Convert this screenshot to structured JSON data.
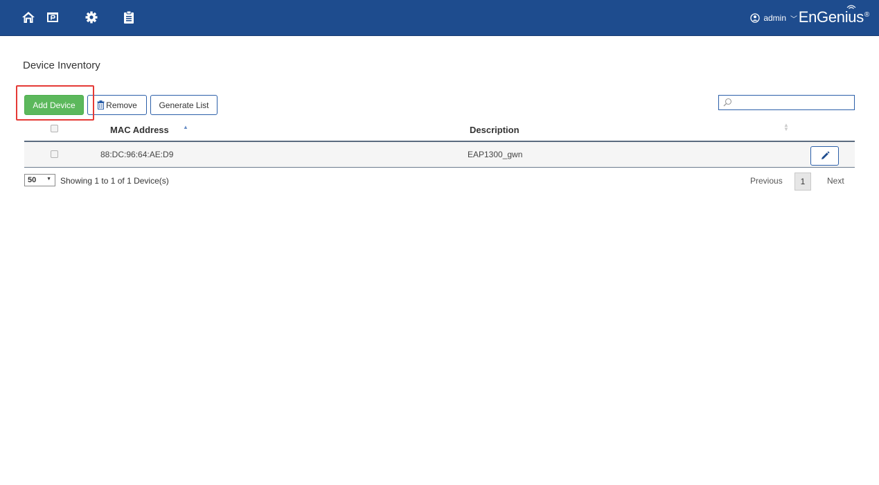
{
  "header": {
    "nav_icons": [
      "home-icon",
      "network-icon",
      "settings-gear-icon",
      "clipboard-list-icon"
    ],
    "user": "admin",
    "brand": "EnGenius",
    "brand_mark": "®"
  },
  "page": {
    "title": "Device Inventory"
  },
  "toolbar": {
    "add_label": "Add Device",
    "remove_label": "Remove",
    "generate_label": "Generate List",
    "search_placeholder": "",
    "search_value": ""
  },
  "table": {
    "columns": [
      "MAC Address",
      "Description"
    ],
    "rows": [
      {
        "mac": "88:DC:96:64:AE:D9",
        "description": "EAP1300_gwn"
      }
    ]
  },
  "footer": {
    "page_size": "50",
    "showing": "Showing 1 to 1 of 1 Device(s)",
    "previous": "Previous",
    "current_page": "1",
    "next": "Next"
  },
  "colors": {
    "topbar": "#1e4c8e",
    "add_button": "#5cb85c",
    "highlight": "#e53935",
    "button_border": "#2a5ea8"
  }
}
